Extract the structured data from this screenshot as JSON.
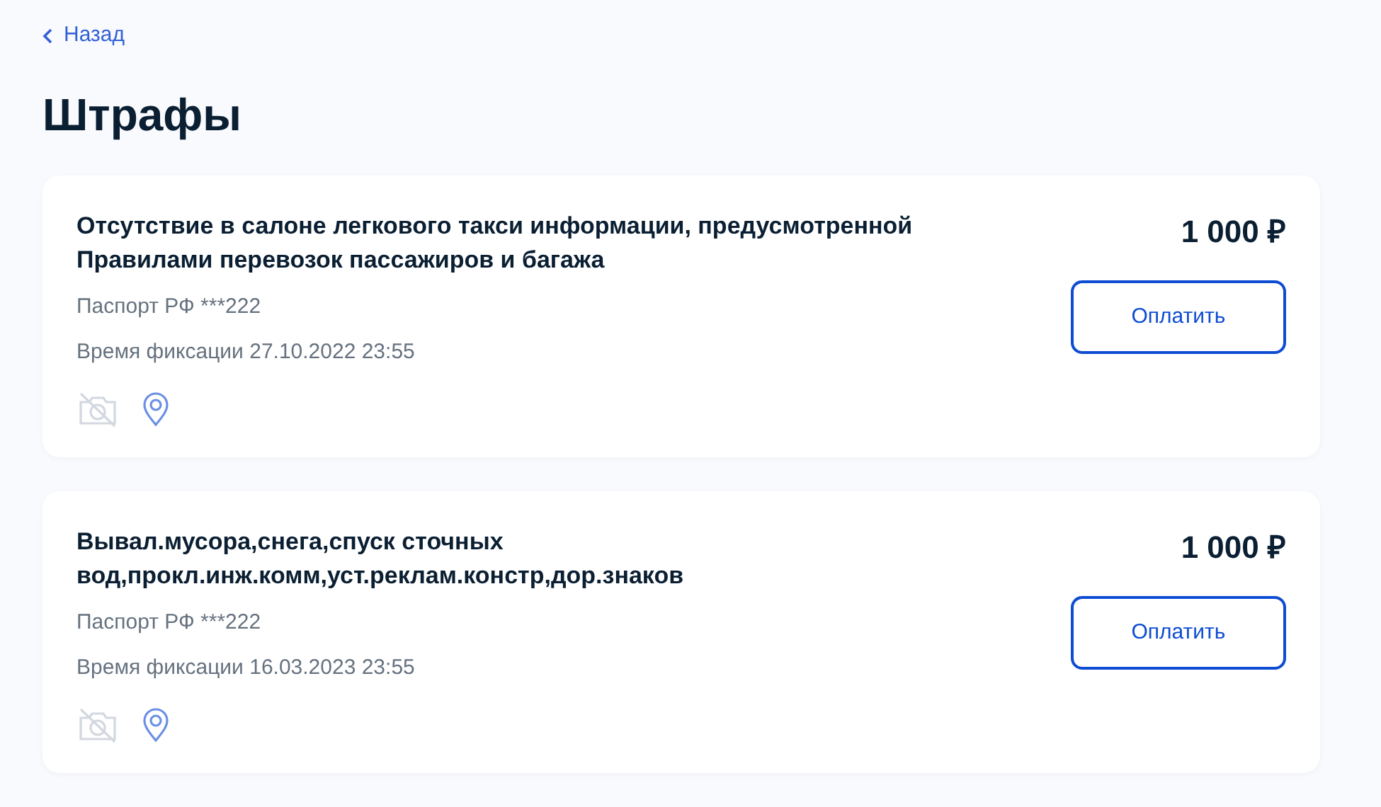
{
  "back_link": "Назад",
  "title": "Штрафы",
  "fines": [
    {
      "description": "Отсутствие в салоне легкового такси информации, предусмотренной Правилами перевозок пассажиров и багажа",
      "document": "Паспорт РФ ***222",
      "fixed_at": "Время фиксации 27.10.2022 23:55",
      "amount": "1 000 ₽",
      "pay_button": "Оплатить",
      "photos_available": false
    },
    {
      "description": "Вывал.мусора,снега,спуск сточных вод,прокл.инж.комм,уст.реклам.констр,дор.знаков",
      "document": "Паспорт РФ ***222",
      "fixed_at": "Время фиксации 16.03.2023 23:55",
      "amount": "1 000 ₽",
      "pay_button": "Оплатить",
      "photos_available": false
    }
  ]
}
